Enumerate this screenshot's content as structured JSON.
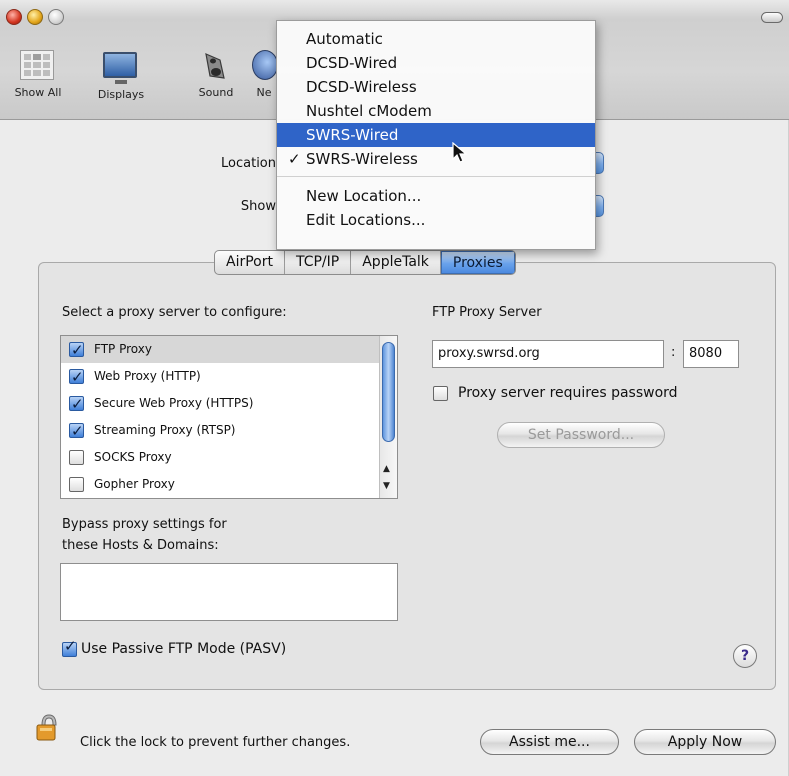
{
  "toolbar": {
    "items": [
      {
        "label": "Show All",
        "icon": "show-all-icon"
      },
      {
        "label": "Displays",
        "icon": "displays-icon"
      },
      {
        "label": "Sound",
        "icon": "sound-icon"
      },
      {
        "label": "Ne",
        "icon": "network-icon"
      }
    ]
  },
  "location_menu": {
    "items": [
      {
        "label": "Automatic",
        "checked": false,
        "highlighted": false
      },
      {
        "label": "DCSD-Wired",
        "checked": false,
        "highlighted": false
      },
      {
        "label": "DCSD-Wireless",
        "checked": false,
        "highlighted": false
      },
      {
        "label": "Nushtel cModem",
        "checked": false,
        "highlighted": false
      },
      {
        "label": "SWRS-Wired",
        "checked": false,
        "highlighted": true
      },
      {
        "label": "SWRS-Wireless",
        "checked": true,
        "highlighted": false
      }
    ],
    "actions": [
      {
        "label": "New Location..."
      },
      {
        "label": "Edit Locations..."
      }
    ],
    "check_mark": "✓"
  },
  "form": {
    "location_label": "Location",
    "show_label": "Show"
  },
  "tabs": [
    {
      "label": "AirPort",
      "active": false
    },
    {
      "label": "TCP/IP",
      "active": false
    },
    {
      "label": "AppleTalk",
      "active": false
    },
    {
      "label": "Proxies",
      "active": true
    }
  ],
  "proxies": {
    "select_label": "Select a proxy server to configure:",
    "list": [
      {
        "label": "FTP Proxy",
        "checked": true,
        "selected": true
      },
      {
        "label": "Web Proxy (HTTP)",
        "checked": true,
        "selected": false
      },
      {
        "label": "Secure Web Proxy (HTTPS)",
        "checked": true,
        "selected": false
      },
      {
        "label": "Streaming Proxy (RTSP)",
        "checked": true,
        "selected": false
      },
      {
        "label": "SOCKS Proxy",
        "checked": false,
        "selected": false
      },
      {
        "label": "Gopher Proxy",
        "checked": false,
        "selected": false
      }
    ],
    "server_heading": "FTP Proxy Server",
    "server_value": "proxy.swrsd.org",
    "port_separator": ":",
    "port_value": "8080",
    "password_checkbox_label": "Proxy server requires password",
    "set_password_label": "Set Password...",
    "bypass_label_line1": "Bypass proxy settings for",
    "bypass_label_line2": "these Hosts & Domains:",
    "bypass_value": "",
    "passive_label": "Use Passive FTP Mode (PASV)",
    "passive_checked": true
  },
  "footer": {
    "lock_text": "Click the lock to prevent further changes.",
    "assist_label": "Assist me...",
    "apply_label": "Apply Now",
    "help_label": "?"
  },
  "colors": {
    "highlight": "#2f64c8",
    "aqua_blue": "#4b89df",
    "window_bg": "#ececec"
  }
}
